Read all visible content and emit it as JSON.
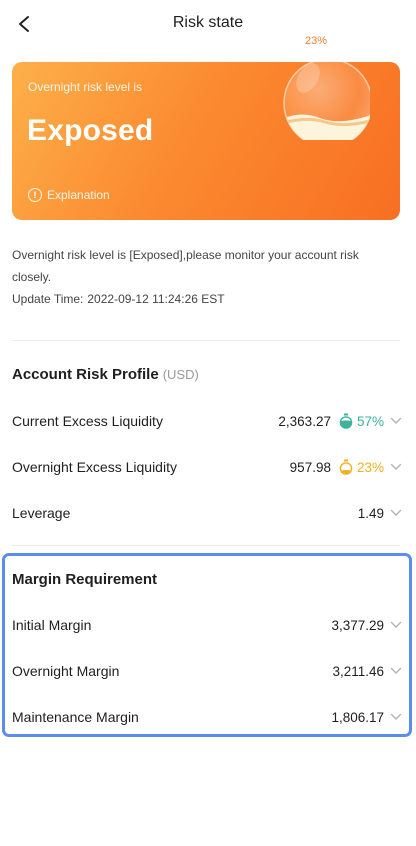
{
  "nav": {
    "title": "Risk state",
    "back_icon": "chevron-left-icon"
  },
  "risk_card": {
    "subtitle": "Overnight risk level is",
    "level": "Exposed",
    "badge": "23%",
    "explanation_label": "Explanation",
    "fill_fraction": 0.23,
    "colors": {
      "gradient_start": "#fdb04a",
      "gradient_end": "#f86f22"
    }
  },
  "description": "Overnight risk level is [Exposed],please monitor your account risk closely.",
  "update": {
    "label": "Update Time:",
    "value": "2022-09-12 11:24:26 EST"
  },
  "account_risk": {
    "title": "Account Risk Profile",
    "unit": "(USD)",
    "rows": [
      {
        "label": "Current Excess Liquidity",
        "value": "2,363.27",
        "percent": "57%",
        "color": "#3db39c",
        "gauge_fill": 0.57
      },
      {
        "label": "Overnight Excess Liquidity",
        "value": "957.98",
        "percent": "23%",
        "color": "#f2b01e",
        "gauge_fill": 0.23
      },
      {
        "label": "Leverage",
        "value": "1.49"
      }
    ]
  },
  "margin": {
    "title": "Margin Requirement",
    "rows": [
      {
        "label": "Initial Margin",
        "value": "3,377.29"
      },
      {
        "label": "Overnight Margin",
        "value": "3,211.46"
      },
      {
        "label": "Maintenance Margin",
        "value": "1,806.17"
      }
    ]
  }
}
